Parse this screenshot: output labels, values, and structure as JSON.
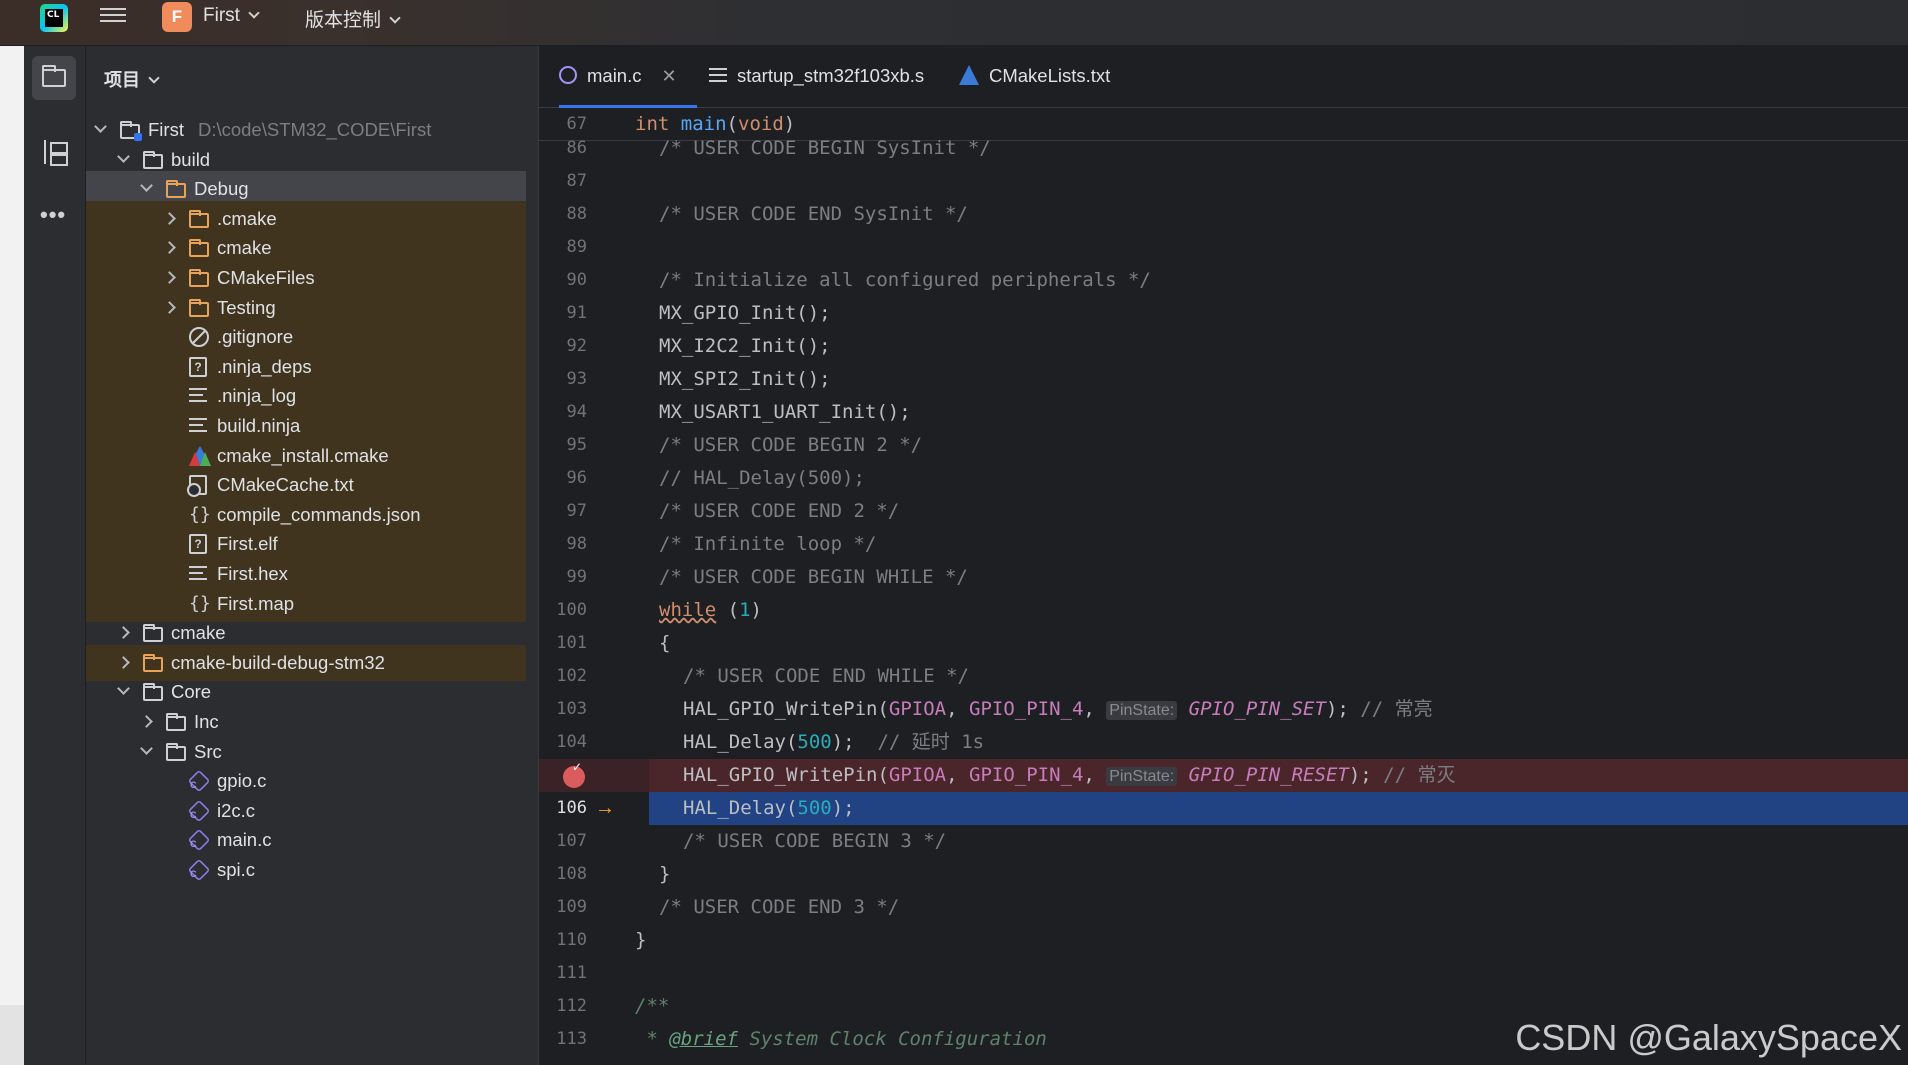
{
  "titlebar": {
    "logo_text": "CL",
    "project_badge": "F",
    "project_name": "First",
    "vcs_menu": "版本控制"
  },
  "project_panel": {
    "header": "项目",
    "tree": [
      {
        "label": "First",
        "path": "D:\\code\\STM32_CODE\\First",
        "icon": "module-folder-icon",
        "expand": "down",
        "indent": 0,
        "excluded": false
      },
      {
        "label": "build",
        "icon": "folder-icon",
        "expand": "down",
        "indent": 1,
        "excluded": false
      },
      {
        "label": "Debug",
        "icon": "folder-orange-icon",
        "expand": "down",
        "indent": 2,
        "excluded": true,
        "selected": true
      },
      {
        "label": ".cmake",
        "icon": "folder-orange-icon",
        "expand": "right",
        "indent": 3,
        "excluded": true
      },
      {
        "label": "cmake",
        "icon": "folder-orange-icon",
        "expand": "right",
        "indent": 3,
        "excluded": true
      },
      {
        "label": "CMakeFiles",
        "icon": "folder-orange-icon",
        "expand": "right",
        "indent": 3,
        "excluded": true
      },
      {
        "label": "Testing",
        "icon": "folder-orange-icon",
        "expand": "right",
        "indent": 3,
        "excluded": true
      },
      {
        "label": ".gitignore",
        "icon": "ignore-file-icon",
        "expand": "none",
        "indent": 3,
        "excluded": true
      },
      {
        "label": ".ninja_deps",
        "icon": "unknown-file-icon",
        "expand": "none",
        "indent": 3,
        "excluded": true
      },
      {
        "label": ".ninja_log",
        "icon": "text-file-icon",
        "expand": "none",
        "indent": 3,
        "excluded": true
      },
      {
        "label": "build.ninja",
        "icon": "text-file-icon",
        "expand": "none",
        "indent": 3,
        "excluded": true
      },
      {
        "label": "cmake_install.cmake",
        "icon": "cmake-icon",
        "expand": "none",
        "indent": 3,
        "excluded": true
      },
      {
        "label": "CMakeCache.txt",
        "icon": "cache-file-icon",
        "expand": "none",
        "indent": 3,
        "excluded": true
      },
      {
        "label": "compile_commands.json",
        "icon": "json-file-icon",
        "expand": "none",
        "indent": 3,
        "excluded": true
      },
      {
        "label": "First.elf",
        "icon": "unknown-file-icon",
        "expand": "none",
        "indent": 3,
        "excluded": true
      },
      {
        "label": "First.hex",
        "icon": "text-file-icon",
        "expand": "none",
        "indent": 3,
        "excluded": true
      },
      {
        "label": "First.map",
        "icon": "json-file-icon",
        "expand": "none",
        "indent": 3,
        "excluded": true
      },
      {
        "label": "cmake",
        "icon": "folder-icon",
        "expand": "right",
        "indent": 1,
        "excluded": false
      },
      {
        "label": "cmake-build-debug-stm32",
        "icon": "folder-orange-icon",
        "expand": "right",
        "indent": 1,
        "excluded": true
      },
      {
        "label": "Core",
        "icon": "folder-icon",
        "expand": "down",
        "indent": 1,
        "excluded": false
      },
      {
        "label": "Inc",
        "icon": "folder-icon",
        "expand": "right",
        "indent": 2,
        "excluded": false
      },
      {
        "label": "Src",
        "icon": "folder-icon",
        "expand": "down",
        "indent": 2,
        "excluded": false
      },
      {
        "label": "gpio.c",
        "icon": "c-file-icon",
        "expand": "none",
        "indent": 3,
        "excluded": false
      },
      {
        "label": "i2c.c",
        "icon": "c-file-icon",
        "expand": "none",
        "indent": 3,
        "excluded": false
      },
      {
        "label": "main.c",
        "icon": "c-file-icon",
        "expand": "none",
        "indent": 3,
        "excluded": false
      },
      {
        "label": "spi.c",
        "icon": "c-file-icon",
        "expand": "none",
        "indent": 3,
        "excluded": false
      }
    ]
  },
  "editor": {
    "tabs": [
      {
        "label": "main.c",
        "icon": "c-file-icon",
        "active": true,
        "closable": true
      },
      {
        "label": "startup_stm32f103xb.s",
        "icon": "text-file-icon",
        "active": false,
        "closable": false
      },
      {
        "label": "CMakeLists.txt",
        "icon": "cmake-icon",
        "active": false,
        "closable": false
      }
    ],
    "sticky_header": {
      "num": "67",
      "html": "<span class=\"kw\">int</span> <span class=\"fn\">main</span>(<span class=\"kw\">void</span>)"
    },
    "lines": [
      {
        "num": "86",
        "indent": 1,
        "html": "<span class=\"cm\">/* USER CODE BEGIN SysInit */</span>"
      },
      {
        "num": "87",
        "indent": 0,
        "html": ""
      },
      {
        "num": "88",
        "indent": 1,
        "html": "<span class=\"cm\">/* USER CODE END SysInit */</span>"
      },
      {
        "num": "89",
        "indent": 0,
        "html": ""
      },
      {
        "num": "90",
        "indent": 1,
        "html": "<span class=\"cm\">/* Initialize all configured peripherals */</span>"
      },
      {
        "num": "91",
        "indent": 1,
        "html": "MX_GPIO_Init();"
      },
      {
        "num": "92",
        "indent": 1,
        "html": "MX_I2C2_Init();"
      },
      {
        "num": "93",
        "indent": 1,
        "html": "MX_SPI2_Init();"
      },
      {
        "num": "94",
        "indent": 1,
        "html": "MX_USART1_UART_Init();"
      },
      {
        "num": "95",
        "indent": 1,
        "html": "<span class=\"cm\">/* USER CODE BEGIN 2 */</span>"
      },
      {
        "num": "96",
        "indent": 1,
        "html": "<span class=\"cm\">// HAL_Delay(500);</span>"
      },
      {
        "num": "97",
        "indent": 1,
        "html": "<span class=\"cm\">/* USER CODE END 2 */</span>"
      },
      {
        "num": "98",
        "indent": 1,
        "html": "<span class=\"cm\">/* Infinite loop */</span>"
      },
      {
        "num": "99",
        "indent": 1,
        "html": "<span class=\"cm\">/* USER CODE BEGIN WHILE */</span>"
      },
      {
        "num": "100",
        "indent": 1,
        "html": "<span class=\"kw wavy\">while</span> (<span class=\"num-lit\">1</span>)"
      },
      {
        "num": "101",
        "indent": 1,
        "html": "{"
      },
      {
        "num": "102",
        "indent": 2,
        "html": "<span class=\"cm\">/* USER CODE END WHILE */</span>"
      },
      {
        "num": "103",
        "indent": 2,
        "html": "HAL_GPIO_WritePin(<span class=\"const\">GPIOA</span>, <span class=\"const\">GPIO_PIN_4</span>, <span class=\"hint\">PinState:</span> <span class=\"param-val\">GPIO_PIN_SET</span>); <span class=\"cm\">// 常亮</span>"
      },
      {
        "num": "104",
        "indent": 2,
        "html": "HAL_Delay(<span class=\"num-lit\">500</span>);  <span class=\"cm\">// 延时 1s</span>"
      },
      {
        "num": "",
        "indent": 2,
        "breakpoint": true,
        "html": "HAL_GPIO_WritePin(<span class=\"const\">GPIOA</span>, <span class=\"const\">GPIO_PIN_4</span>, <span class=\"hint\">PinState:</span> <span class=\"param-val\">GPIO_PIN_RESET</span>); <span class=\"cm\">// 常灭</span>"
      },
      {
        "num": "106",
        "indent": 2,
        "current": true,
        "html": "HAL_Delay(<span class=\"num-lit\">500</span>);"
      },
      {
        "num": "107",
        "indent": 2,
        "html": "<span class=\"cm\">/* USER CODE BEGIN 3 */</span>"
      },
      {
        "num": "108",
        "indent": 1,
        "html": "}"
      },
      {
        "num": "109",
        "indent": 1,
        "html": "<span class=\"cm\">/* USER CODE END 3 */</span>"
      },
      {
        "num": "110",
        "indent": 0,
        "html": "}"
      },
      {
        "num": "111",
        "indent": 0,
        "html": ""
      },
      {
        "num": "112",
        "indent": 0,
        "html": "<span class=\"doc\">/**</span>"
      },
      {
        "num": "113",
        "indent": 0,
        "html": "<span class=\"doc\"> * <span class=\"doc-tag\">@brief</span> System Clock Configuration</span>"
      }
    ]
  },
  "watermark": "CSDN @GalaxySpaceX"
}
